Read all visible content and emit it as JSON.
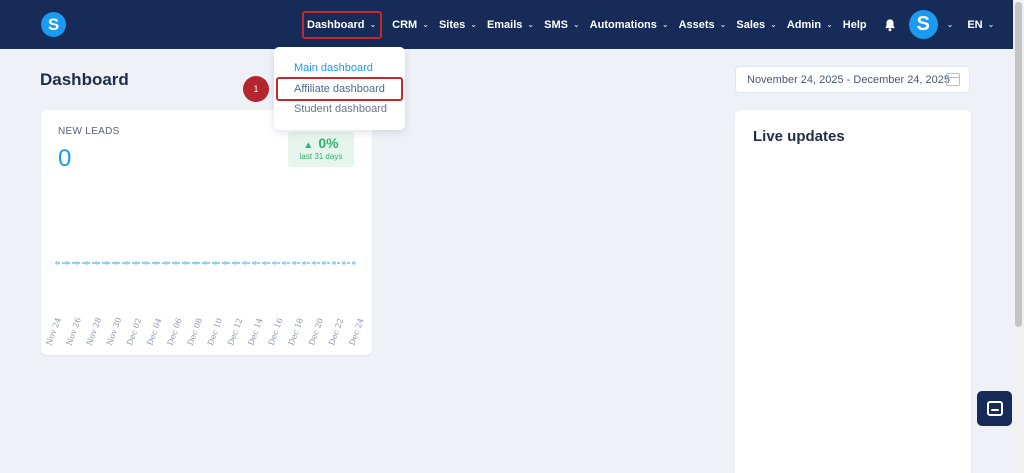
{
  "header": {
    "logo_letter": "S",
    "nav": [
      {
        "label": "Dashboard"
      },
      {
        "label": "CRM"
      },
      {
        "label": "Sites"
      },
      {
        "label": "Emails"
      },
      {
        "label": "SMS"
      },
      {
        "label": "Automations"
      },
      {
        "label": "Assets"
      },
      {
        "label": "Sales"
      },
      {
        "label": "Admin"
      }
    ],
    "help_label": "Help",
    "avatar_letter": "S",
    "language": "EN"
  },
  "dashboard_menu": {
    "items": [
      {
        "label": "Main dashboard"
      },
      {
        "label": "Affiliate dashboard"
      },
      {
        "label": "Student dashboard"
      }
    ],
    "step_number": "1"
  },
  "page": {
    "title": "Dashboard",
    "date_range": "November 24, 2025 - December 24, 2025"
  },
  "new_leads": {
    "label": "NEW LEADS",
    "value": "0",
    "change": "0%",
    "change_period": "last 31 days",
    "change_direction": "up"
  },
  "chart_data": {
    "type": "line",
    "categories": [
      "Nov 24",
      "Nov 26",
      "Nov 28",
      "Nov 30",
      "Dec 02",
      "Dec 04",
      "Dec 06",
      "Dec 08",
      "Dec 10",
      "Dec 12",
      "Dec 14",
      "Dec 16",
      "Dec 18",
      "Dec 20",
      "Dec 22",
      "Dec 24"
    ],
    "values": [
      0,
      0,
      0,
      0,
      0,
      0,
      0,
      0,
      0,
      0,
      0,
      0,
      0,
      0,
      0,
      0,
      0,
      0,
      0,
      0,
      0,
      0,
      0,
      0,
      0,
      0,
      0,
      0,
      0,
      0,
      0
    ],
    "series_color": "#8fd3ec",
    "title": "",
    "xlabel": "",
    "ylabel": ""
  },
  "live_updates": {
    "title": "Live updates"
  },
  "colors": {
    "nav_bg": "#162b57",
    "accent": "#1a9af0",
    "highlight": "#c8272e",
    "positive": "#2fb36a"
  }
}
